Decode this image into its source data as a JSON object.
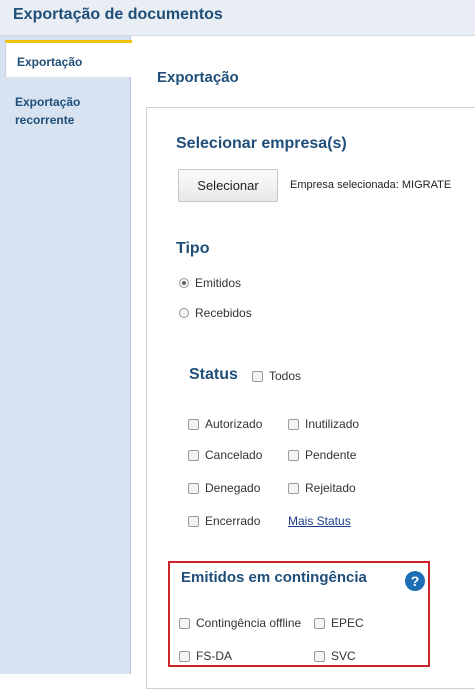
{
  "window": {
    "title": "Exportação de documentos"
  },
  "sidebar": {
    "tabs": [
      {
        "label": "Exportação",
        "active": true
      },
      {
        "label": "Exportação recorrente",
        "active": false
      }
    ]
  },
  "main": {
    "title": "Exportação",
    "empresa": {
      "title": "Selecionar empresa(s)",
      "button": "Selecionar",
      "selected_text": "Empresa selecionada: MIGRATE"
    },
    "tipo": {
      "title": "Tipo",
      "options": [
        {
          "label": "Emitidos",
          "selected": true
        },
        {
          "label": "Recebidos",
          "selected": false
        }
      ]
    },
    "status": {
      "title": "Status",
      "todos_label": "Todos",
      "options": [
        "Autorizado",
        "Inutilizado",
        "Cancelado",
        "Pendente",
        "Denegado",
        "Rejeitado",
        "Encerrado"
      ],
      "more_link": "Mais Status"
    },
    "contingencia": {
      "title": "Emitidos em contingência",
      "help_icon": "?",
      "options": [
        "Contingência offline",
        "EPEC",
        "FS-DA",
        "SVC"
      ],
      "highlight_color": "#cc2229"
    }
  },
  "colors": {
    "accent": "#1f4e79",
    "tab_marker": "#f2c200",
    "sidebar_bg": "#d7e3f0",
    "link": "#1a3e8c"
  }
}
